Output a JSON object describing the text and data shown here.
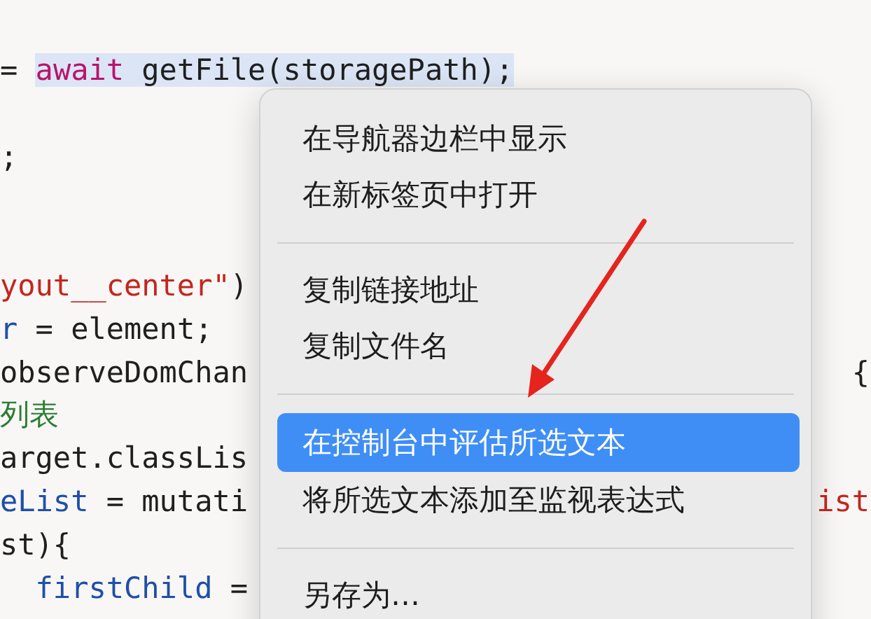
{
  "editor": {
    "lines": [
      {
        "kind": "code",
        "segments": [
          {
            "text": "= ",
            "kind": "plain",
            "selected": false
          },
          {
            "text": "await",
            "kind": "keyword",
            "selected": true
          },
          {
            "text": " getFile(storagePath);",
            "kind": "plain",
            "selected": true
          }
        ]
      },
      {
        "kind": "blank"
      },
      {
        "kind": "code",
        "segments": [
          {
            "text": ";",
            "kind": "plain",
            "selected": false
          }
        ]
      },
      {
        "kind": "blank"
      },
      {
        "kind": "blank"
      },
      {
        "kind": "code",
        "segments": [
          {
            "text": "yout__center\"",
            "kind": "string",
            "selected": false
          },
          {
            "text": ")",
            "kind": "plain",
            "selected": false
          }
        ]
      },
      {
        "kind": "code",
        "segments": [
          {
            "text": "r",
            "kind": "variable",
            "selected": false
          },
          {
            "text": " = element;",
            "kind": "plain",
            "selected": false
          }
        ]
      },
      {
        "kind": "code",
        "segments": [
          {
            "text": "observeDomChan",
            "kind": "plain",
            "selected": false
          }
        ],
        "tail": {
          "text": "{",
          "kind": "plain"
        }
      },
      {
        "kind": "code",
        "segments": [
          {
            "text": "列表",
            "kind": "comment",
            "selected": false
          }
        ]
      },
      {
        "kind": "code",
        "segments": [
          {
            "text": "arget.classLis",
            "kind": "plain",
            "selected": false
          }
        ]
      },
      {
        "kind": "code",
        "segments": [
          {
            "text": "eList",
            "kind": "variable",
            "selected": false
          },
          {
            "text": " = mutati",
            "kind": "plain",
            "selected": false
          }
        ],
        "tail": {
          "text": "ist",
          "kind": "string"
        }
      },
      {
        "kind": "code",
        "segments": [
          {
            "text": "st){",
            "kind": "plain",
            "selected": false
          }
        ]
      },
      {
        "kind": "code",
        "segments": [
          {
            "text": "  firstChild",
            "kind": "variable",
            "selected": false
          },
          {
            "text": " =",
            "kind": "plain",
            "selected": false
          }
        ]
      }
    ]
  },
  "context_menu": {
    "items": [
      {
        "kind": "item",
        "label": "在导航器边栏中显示",
        "selected": false
      },
      {
        "kind": "item",
        "label": "在新标签页中打开",
        "selected": false
      },
      {
        "kind": "separator"
      },
      {
        "kind": "item",
        "label": "复制链接地址",
        "selected": false
      },
      {
        "kind": "item",
        "label": "复制文件名",
        "selected": false
      },
      {
        "kind": "separator"
      },
      {
        "kind": "item",
        "label": "在控制台中评估所选文本",
        "selected": true
      },
      {
        "kind": "item",
        "label": "将所选文本添加至监视表达式",
        "selected": false
      },
      {
        "kind": "separator"
      },
      {
        "kind": "item",
        "label": "另存为…",
        "selected": false
      }
    ]
  }
}
